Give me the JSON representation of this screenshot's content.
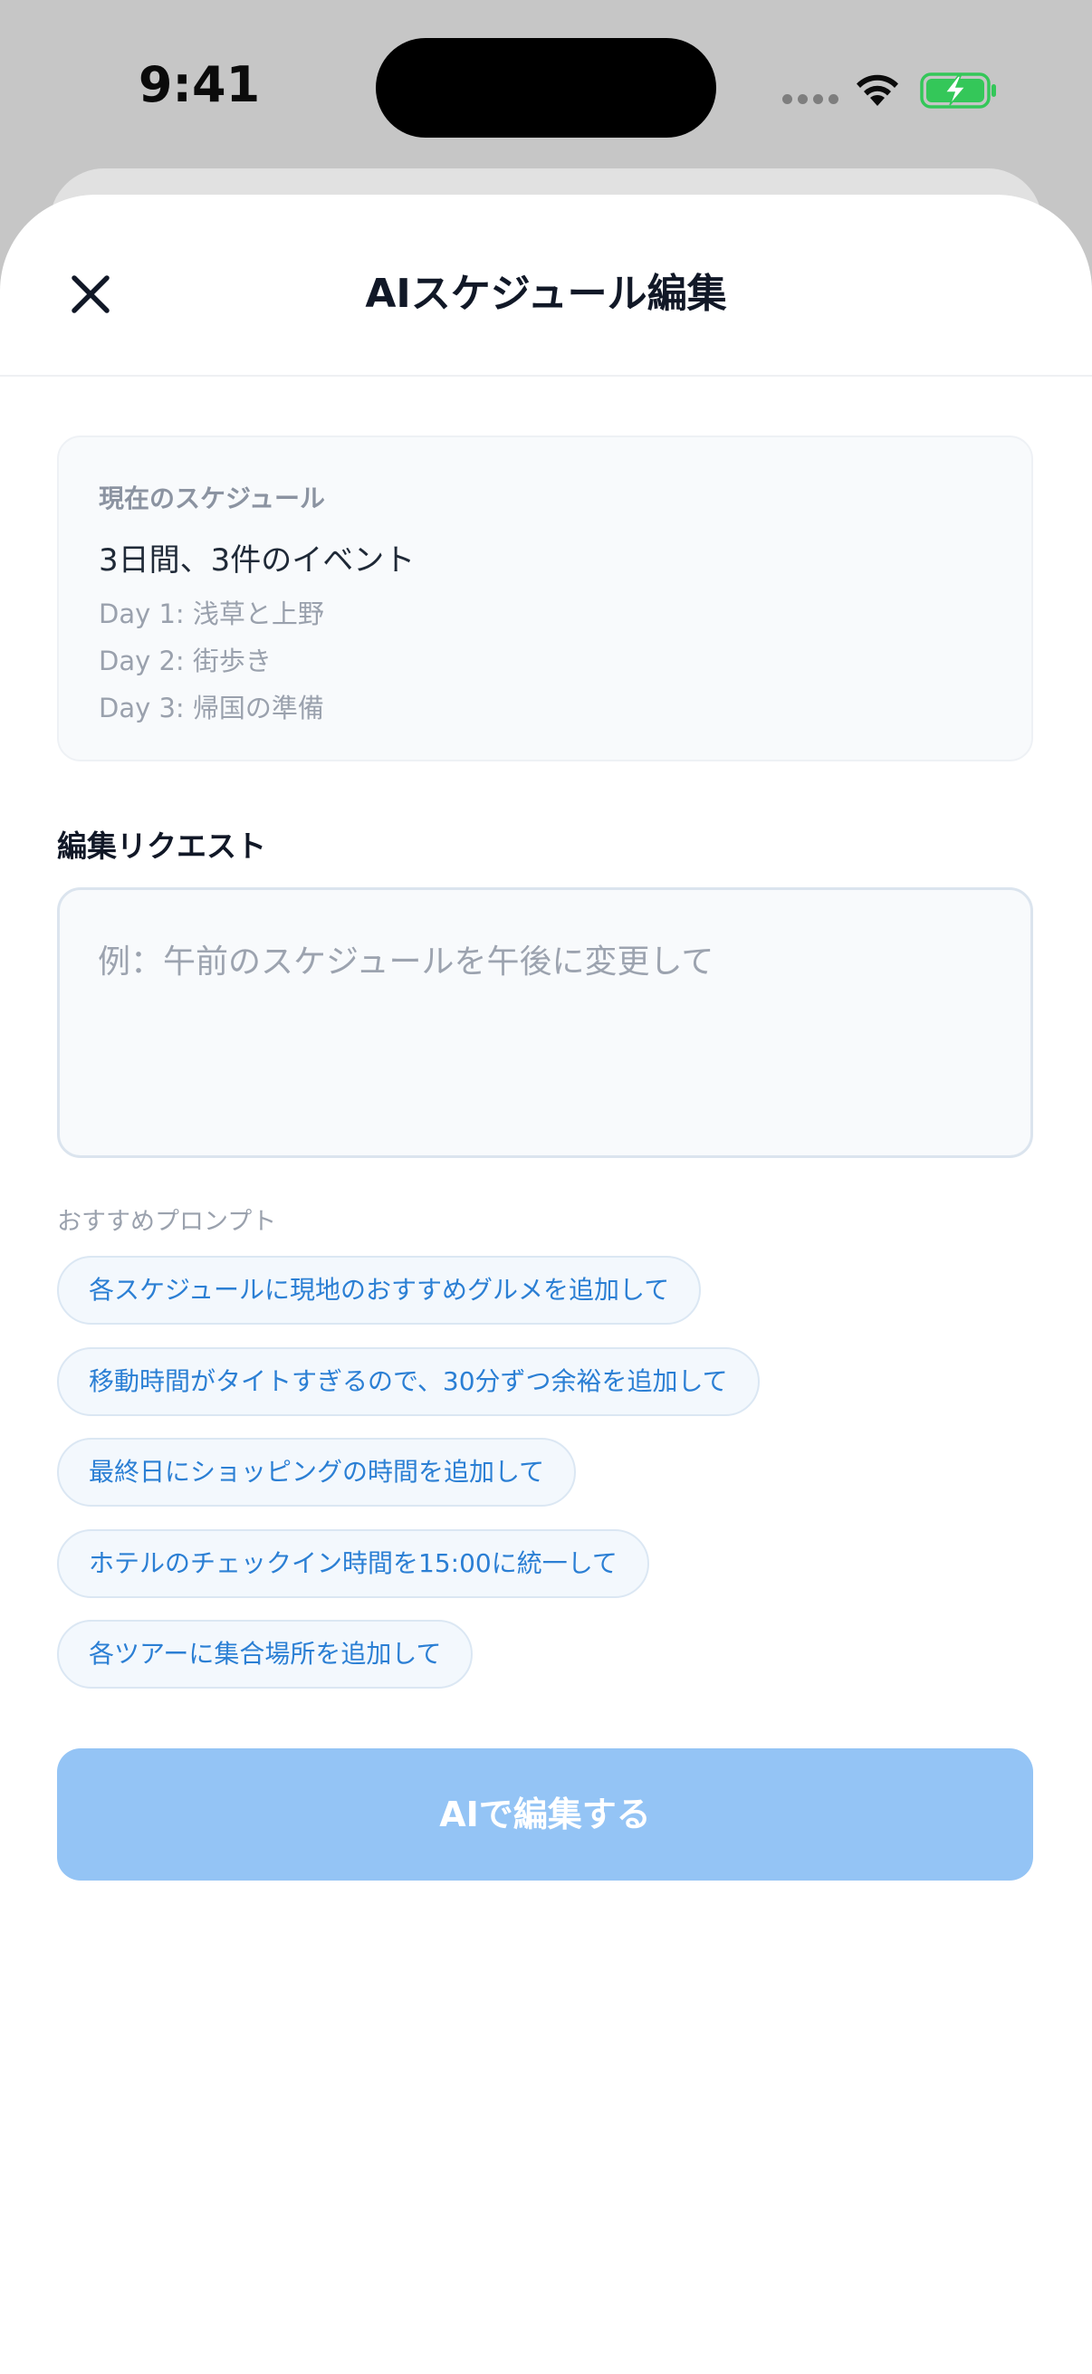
{
  "status_bar": {
    "time": "9:41"
  },
  "header": {
    "title": "AIスケジュール編集"
  },
  "current_schedule": {
    "label": "現在のスケジュール",
    "summary": "3日間、3件のイベント",
    "days": [
      "Day 1: 浅草と上野",
      "Day 2: 街歩き",
      "Day 3: 帰国の準備"
    ]
  },
  "edit_request": {
    "label": "編集リクエスト",
    "value": "",
    "placeholder": "例：午前のスケジュールを午後に変更して"
  },
  "suggested_prompts": {
    "label": "おすすめプロンプト",
    "items": [
      "各スケジュールに現地のおすすめグルメを追加して",
      "移動時間がタイトすぎるので、30分ずつ余裕を追加して",
      "最終日にショッピングの時間を追加して",
      "ホテルのチェックイン時間を15:00に統一して",
      "各ツアーに集合場所を追加して"
    ]
  },
  "submit": {
    "label": "AIで編集する"
  },
  "colors": {
    "accent": "#2b7fd4",
    "button_disabled": "#94c4f5",
    "battery_green": "#34c759"
  }
}
